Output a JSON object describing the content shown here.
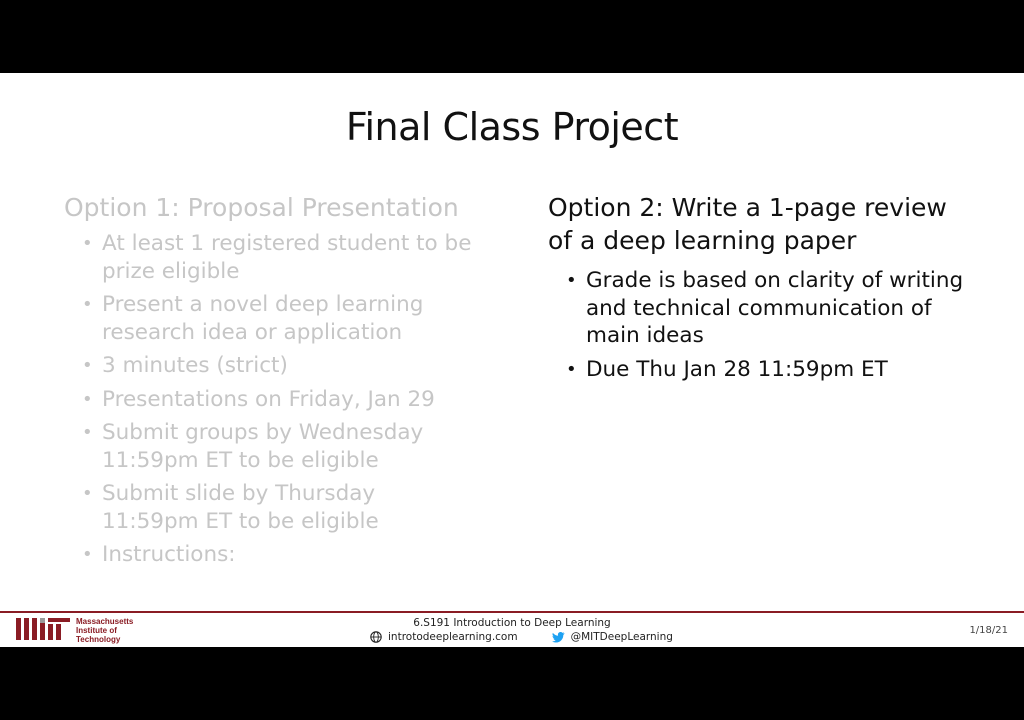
{
  "slide": {
    "title": "Final Class Project",
    "option1": {
      "heading_number": "Option 1",
      "heading_text": ": Proposal Presentation",
      "bullets": [
        "At least 1 registered student to be prize eligible",
        "Present a novel deep learning research idea or application",
        "3 minutes (strict)",
        "Presentations on Friday, Jan 29",
        "Submit groups by Wednesday 11:59pm ET to be eligible",
        "Submit slide by Thursday 11:59pm ET to be eligible",
        "Instructions:"
      ]
    },
    "option2": {
      "heading": "Option 2: Write a 1-page review of a deep learning paper",
      "bullets": [
        "Grade is based on clarity of writing and technical communication of main ideas",
        "Due Thu Jan 28 11:59pm ET"
      ]
    }
  },
  "footer": {
    "institution_lines": [
      "Massachusetts",
      "Institute of",
      "Technology"
    ],
    "course": "6.S191 Introduction to Deep Learning",
    "website": "introtodeeplearning.com",
    "twitter": "@MITDeepLearning",
    "date": "1/18/21",
    "accent_color": "#8a1c24"
  }
}
